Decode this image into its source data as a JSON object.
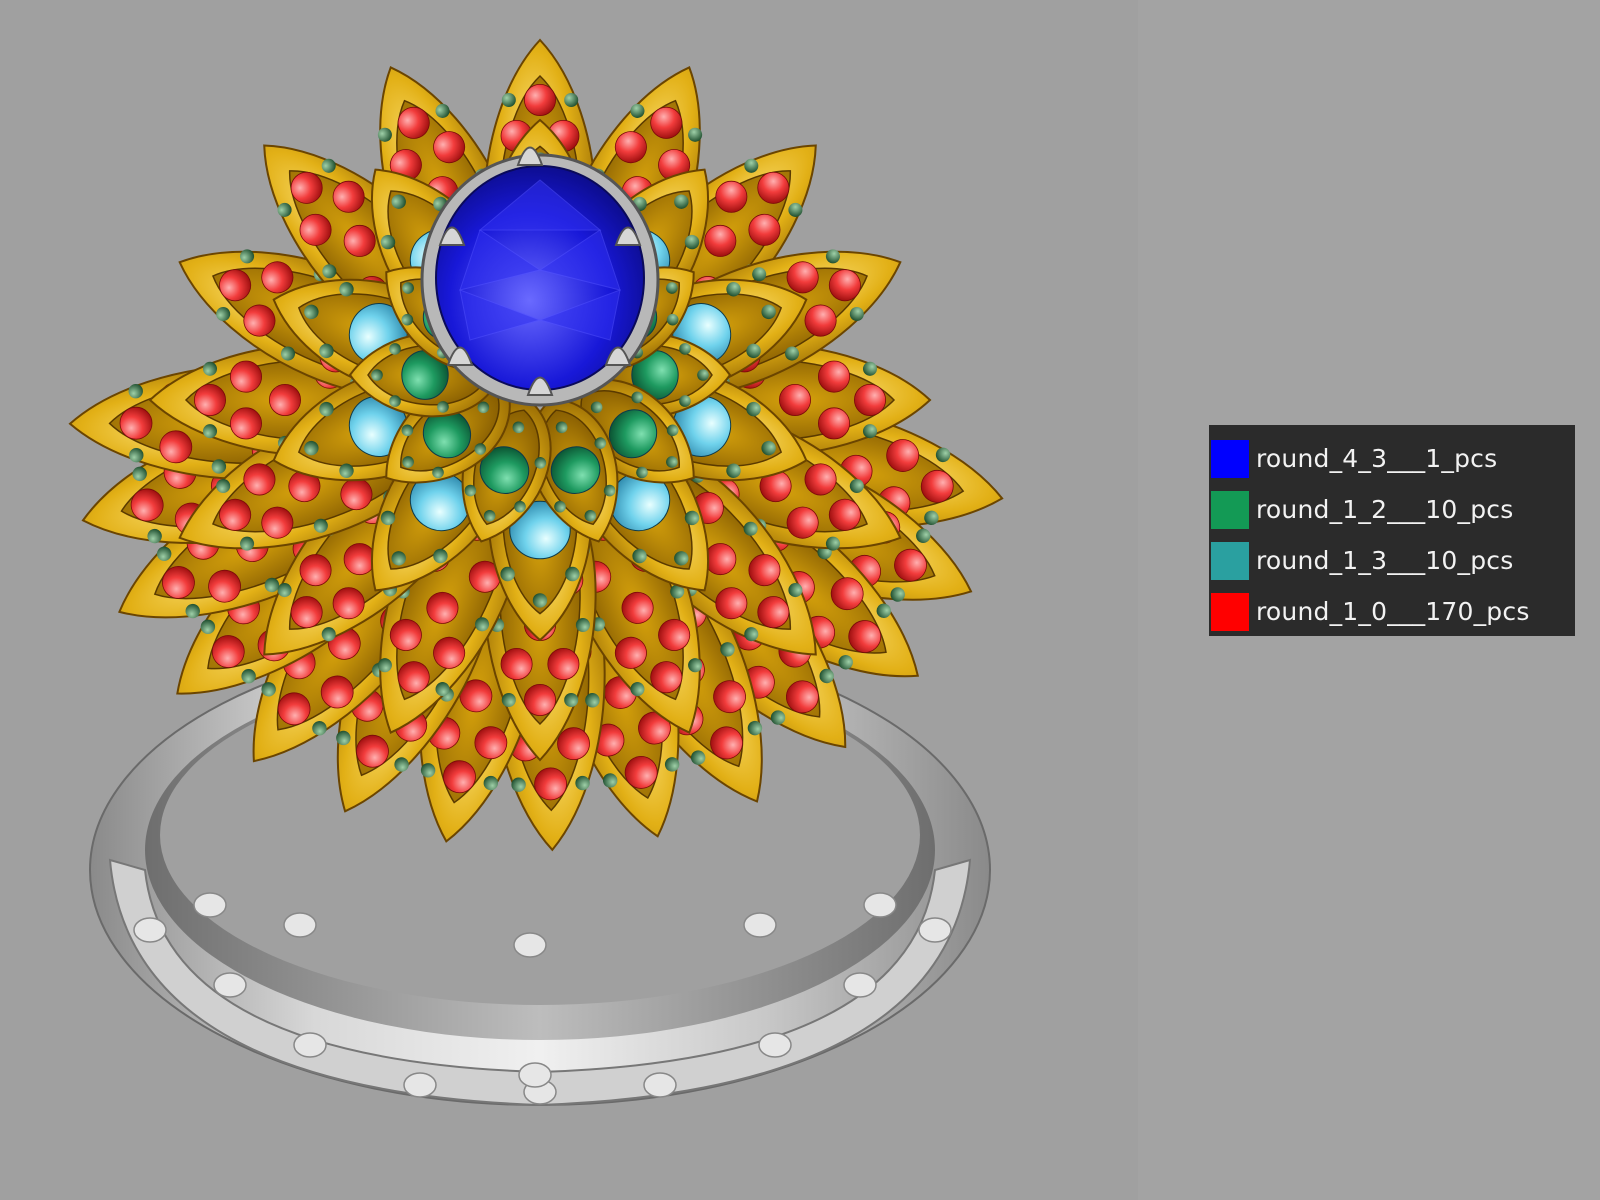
{
  "viewport": {
    "background": "#a0a0a0",
    "model": {
      "subject": "ring",
      "band_color": "#b8b8b8",
      "metal_color": "#d4a20a",
      "center_stone_color": "#1a1ad8",
      "prong_color": "#c8c8c8"
    }
  },
  "legend": {
    "background": "#2b2b2b",
    "items": [
      {
        "label": "round_4_3___1_pcs",
        "color": "#0000ff"
      },
      {
        "label": "round_1_2___10_pcs",
        "color": "#139a55"
      },
      {
        "label": "round_1_3___10_pcs",
        "color": "#2aa0a0"
      },
      {
        "label": "round_1_0___170_pcs",
        "color": "#ff0000"
      }
    ]
  }
}
